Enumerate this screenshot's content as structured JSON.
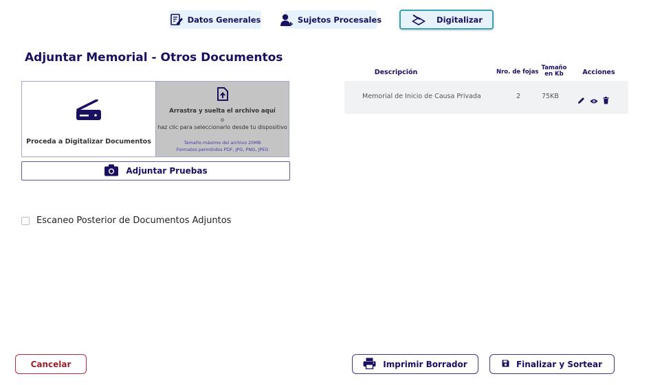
{
  "tabs": [
    {
      "label": "Datos Generales",
      "icon": "edit-document-icon",
      "active": false
    },
    {
      "label": "Sujetos Procesales",
      "icon": "add-user-icon",
      "active": false
    },
    {
      "label": "Digitalizar",
      "icon": "scanner-icon",
      "active": true
    }
  ],
  "page_title": "Adjuntar Memorial - Otros Documentos",
  "digitalize": {
    "label": "Proceda a Digitalizar Documentos",
    "icon": "scanner-icon"
  },
  "dropzone": {
    "icon": "file-upload-icon",
    "title": "Arrastra y suelta el archivo aquí",
    "or": "o",
    "subtitle": "haz clic para seleccionarlo desde tu dispositivo",
    "max_size": "Tamaño máximo del archivo 20MB",
    "formats": "Formatos permitidos PDF, JPG, PNG, JPEG"
  },
  "attach_button": {
    "label": "Adjuntar Pruebas",
    "icon": "camera-icon"
  },
  "scan_later": {
    "label": "Escaneo Posterior de Documentos Adjuntos",
    "checked": false
  },
  "table": {
    "headers": {
      "description": "Descripción",
      "pages": "Nro. de fojas",
      "size_line1": "Tamaño",
      "size_line2": "en Kb",
      "actions": "Acciones"
    },
    "rows": [
      {
        "description": "Memorial de Inicio de Causa Privada",
        "pages": "2",
        "size": "75KB",
        "actions": [
          "edit-icon",
          "view-icon",
          "delete-icon"
        ]
      }
    ]
  },
  "footer": {
    "cancel": "Cancelar",
    "print": "Imprimir Borrador",
    "finish": "Finalizar y Sortear"
  },
  "colors": {
    "primary": "#1a1060",
    "active_border": "#3aa0b3",
    "tab_bg": "#e6f2fc",
    "cancel": "#9e1f2c",
    "dropzone_bg": "#c4c4c4"
  }
}
